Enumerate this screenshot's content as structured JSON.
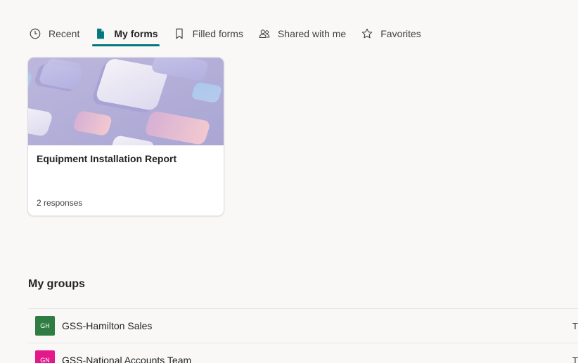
{
  "tabs": [
    {
      "label": "Recent",
      "icon": "clock-icon",
      "active": false
    },
    {
      "label": "My forms",
      "icon": "document-icon",
      "active": true
    },
    {
      "label": "Filled forms",
      "icon": "bookmark-icon",
      "active": false
    },
    {
      "label": "Shared with me",
      "icon": "people-icon",
      "active": false
    },
    {
      "label": "Favorites",
      "icon": "star-icon",
      "active": false
    }
  ],
  "accent_color": "#03787c",
  "forms": [
    {
      "title": "Equipment Installation Report",
      "responses": "2 responses"
    }
  ],
  "groups_section": {
    "title": "My groups",
    "groups": [
      {
        "initials": "GH",
        "name": "GSS-Hamilton Sales",
        "color": "#2f7d43",
        "trailing": "T"
      },
      {
        "initials": "GN",
        "name": "GSS-National Accounts Team",
        "color": "#e3188b",
        "trailing": "T"
      }
    ]
  }
}
